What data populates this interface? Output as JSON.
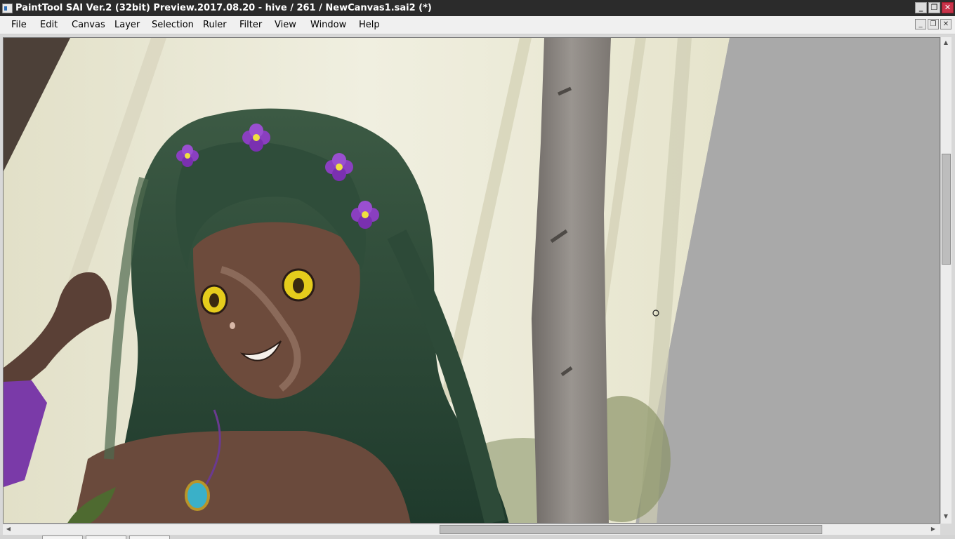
{
  "window": {
    "title": "PaintTool SAI Ver.2 (32bit) Preview.2017.08.20 - hive / 261 / NewCanvas1.sai2 (*)",
    "icon": "app-icon",
    "controls": {
      "minimize": "_",
      "restore": "❐",
      "close": "✕"
    }
  },
  "menu": {
    "items": [
      "File",
      "Edit",
      "Canvas",
      "Layer",
      "Selection",
      "Ruler",
      "Filter",
      "View",
      "Window",
      "Help"
    ],
    "mdi_controls": {
      "minimize": "_",
      "restore": "❐",
      "close": "✕"
    }
  },
  "canvas": {
    "document": "NewCanvas1.sai2",
    "subject": "illustration of a green-haired girl with purple flowers in a misty forest",
    "colors": {
      "background_gray": "#a9a9a9",
      "mist": "#e8e6d2",
      "hair": "#2c4a36",
      "skin": "#6b4a3c",
      "flower": "#8a3fc0",
      "eyes": "#e8d020",
      "trunk": "#8a8580"
    }
  },
  "scrollbars": {
    "up_arrow": "▲",
    "down_arrow": "▼",
    "left_arrow": "◀",
    "right_arrow": "▶"
  }
}
